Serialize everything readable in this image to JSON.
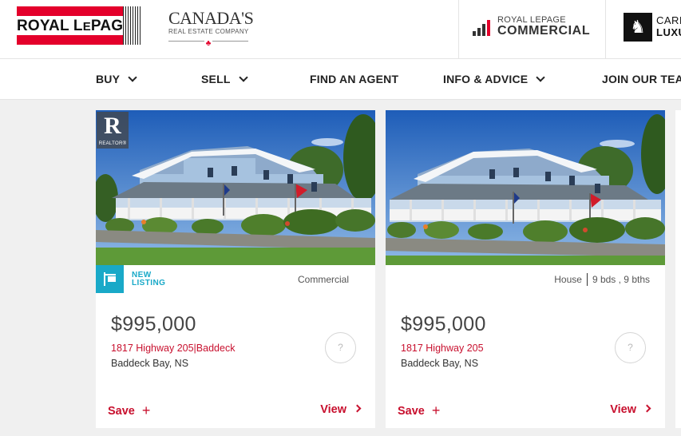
{
  "header": {
    "brand_logo": {
      "main": "ROYAL L",
      "le": "E",
      "tail": "PAGE"
    },
    "canada_logo": {
      "big": "CANADA'S",
      "small": "REAL ESTATE COMPANY"
    },
    "commercial_logo": {
      "top": "ROYAL LEPAGE",
      "bottom": "COMMERCIAL"
    },
    "luxury_logo": {
      "line1": "CARR",
      "line2": "LUXU"
    }
  },
  "nav": {
    "items": [
      {
        "label": "BUY",
        "has_dropdown": true
      },
      {
        "label": "SELL",
        "has_dropdown": true
      },
      {
        "label": "FIND AN AGENT",
        "has_dropdown": false
      },
      {
        "label": "INFO & ADVICE",
        "has_dropdown": true
      },
      {
        "label": "JOIN OUR TEAM",
        "has_dropdown": false
      }
    ]
  },
  "listings": [
    {
      "realtor_badge": "REALTOR®",
      "realtor_mark": "R",
      "new_listing": [
        "NEW",
        "LISTING"
      ],
      "property_type": "Commercial",
      "price": "$995,000",
      "address": "1817 Highway 205|Baddeck",
      "city": "Baddeck Bay, NS",
      "agent_placeholder": "?",
      "save_label": "Save",
      "view_label": "View"
    },
    {
      "property_type": "House",
      "beds_baths": "9 bds , 9 bths",
      "price": "$995,000",
      "address": "1817 Highway 205",
      "city": "Baddeck Bay, NS",
      "agent_placeholder": "?",
      "save_label": "Save",
      "view_label": "View"
    }
  ],
  "colors": {
    "brand_red": "#e4002b",
    "link_red": "#c8102e",
    "new_listing_teal": "#19a9c8",
    "page_bg": "#f0f0f0"
  }
}
